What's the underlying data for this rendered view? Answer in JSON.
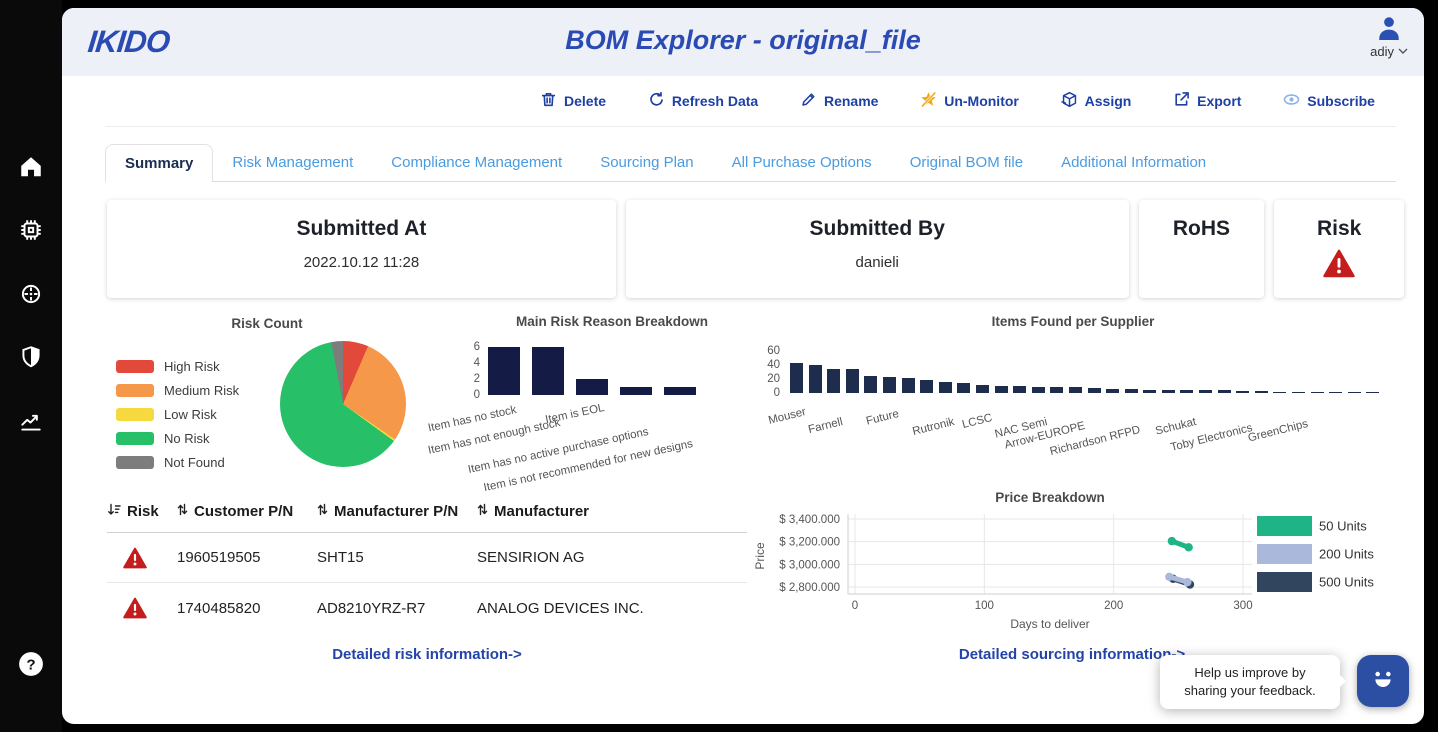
{
  "app": {
    "logo": "IKIDO",
    "title": "BOM Explorer - original_file",
    "user": {
      "name": "adiy"
    }
  },
  "sidebar": {
    "items": [
      {
        "icon": "home-icon"
      },
      {
        "icon": "chip-icon"
      },
      {
        "icon": "target-icon"
      },
      {
        "icon": "shield-icon"
      },
      {
        "icon": "analytics-icon"
      }
    ],
    "help_icon": "help-icon"
  },
  "toolbar": {
    "actions": [
      {
        "label": "Delete",
        "icon": "trash-icon"
      },
      {
        "label": "Refresh Data",
        "icon": "refresh-icon"
      },
      {
        "label": "Rename",
        "icon": "pencil-icon"
      },
      {
        "label": "Un-Monitor",
        "icon": "star-slash-icon"
      },
      {
        "label": "Assign",
        "icon": "cube-icon"
      },
      {
        "label": "Export",
        "icon": "export-icon"
      },
      {
        "label": "Subscribe",
        "icon": "eye-icon"
      }
    ]
  },
  "tabs": [
    {
      "label": "Summary",
      "active": true
    },
    {
      "label": "Risk Management",
      "active": false
    },
    {
      "label": "Compliance Management",
      "active": false
    },
    {
      "label": "Sourcing Plan",
      "active": false
    },
    {
      "label": "All Purchase Options",
      "active": false
    },
    {
      "label": "Original BOM file",
      "active": false
    },
    {
      "label": "Additional Information",
      "active": false
    }
  ],
  "cards": {
    "submitted_at": {
      "title": "Submitted At",
      "value": "2022.10.12 11:28"
    },
    "submitted_by": {
      "title": "Submitted By",
      "value": "danieli"
    },
    "rohs": {
      "title": "RoHS"
    },
    "risk": {
      "title": "Risk",
      "icon": "warning-triangle-icon"
    }
  },
  "table": {
    "columns": [
      {
        "label": "Risk",
        "sort": "desc"
      },
      {
        "label": "Customer P/N",
        "sort": "none"
      },
      {
        "label": "Manufacturer P/N",
        "sort": "none"
      },
      {
        "label": "Manufacturer",
        "sort": "none"
      }
    ],
    "rows": [
      {
        "risk": "high",
        "customer_pn": "1960519505",
        "manufacturer_pn": "SHT15",
        "manufacturer": "SENSIRION AG"
      },
      {
        "risk": "high",
        "customer_pn": "1740485820",
        "manufacturer_pn": "AD8210YRZ-R7",
        "manufacturer": "ANALOG DEVICES INC."
      }
    ]
  },
  "links": {
    "risk": "Detailed risk information->",
    "sourcing": "Detailed sourcing information->"
  },
  "feedback": {
    "tooltip": "Help us improve by sharing your feedback.",
    "icon": "chat-smiley-icon"
  },
  "chart_data": [
    {
      "id": "risk_count",
      "type": "pie",
      "title": "Risk Count",
      "legend_position": "left",
      "slices": [
        {
          "label": "High Risk",
          "value": 6.5,
          "color": "#e2493b"
        },
        {
          "label": "Medium Risk",
          "value": 28,
          "color": "#f5984a"
        },
        {
          "label": "Low Risk",
          "value": 0.5,
          "color": "#f6d93f"
        },
        {
          "label": "No Risk",
          "value": 62,
          "color": "#28bf69"
        },
        {
          "label": "Not Found",
          "value": 3,
          "color": "#7d7d7d"
        }
      ]
    },
    {
      "id": "risk_reasons",
      "type": "bar",
      "title": "Main Risk Reason Breakdown",
      "categories": [
        "Item has no stock",
        "Item has not enough stock",
        "Item is EOL",
        "Item has no active purchase options",
        "Item is not recommended for new designs"
      ],
      "values": [
        6,
        6,
        2,
        1,
        1
      ],
      "ylim": [
        0,
        6
      ],
      "yticks": [
        0,
        2,
        4,
        6
      ],
      "bar_color": "#141b44",
      "grid": false
    },
    {
      "id": "items_per_supplier",
      "type": "bar",
      "title": "Items Found per Supplier",
      "values": [
        43,
        40,
        35,
        34,
        24,
        23,
        21,
        18,
        16,
        14,
        11,
        10,
        10,
        9,
        8,
        8,
        7,
        6,
        6,
        5,
        5,
        4,
        4,
        4,
        3,
        3,
        2,
        2,
        2,
        1,
        1,
        1
      ],
      "labels": [
        {
          "index": 0,
          "label": "Mouser"
        },
        {
          "index": 2,
          "label": "Farnell"
        },
        {
          "index": 5,
          "label": "Future"
        },
        {
          "index": 8,
          "label": "Rutronik"
        },
        {
          "index": 10,
          "label": "LCSC"
        },
        {
          "index": 13,
          "label": "NAC Semi"
        },
        {
          "index": 15,
          "label": "Arrow-EUROPE"
        },
        {
          "index": 18,
          "label": "Richardson RFPD"
        },
        {
          "index": 21,
          "label": "Schukat"
        },
        {
          "index": 24,
          "label": "Toby Electronics"
        },
        {
          "index": 27,
          "label": "GreenChips"
        }
      ],
      "ylim": [
        0,
        60
      ],
      "yticks": [
        0,
        20,
        40,
        60
      ],
      "bar_color": "#1e2d4d",
      "grid": false
    },
    {
      "id": "price_breakdown",
      "type": "line",
      "title": "Price Breakdown",
      "xlabel": "Days to deliver",
      "ylabel": "Price",
      "xticks": [
        0,
        100,
        200,
        300
      ],
      "xlim": [
        0,
        300
      ],
      "yticks": [
        {
          "label": "$ 3,400.000",
          "value": 3400
        },
        {
          "label": "$ 3,200.000",
          "value": 3200
        },
        {
          "label": "$ 3,000.000",
          "value": 3000
        },
        {
          "label": "$ 2,800.000",
          "value": 2800
        }
      ],
      "grid": true,
      "legend_position": "right",
      "series": [
        {
          "name": "50 Units",
          "color": "#1fb486",
          "points": [
            [
              245,
              3205
            ],
            [
              258,
              3150
            ]
          ]
        },
        {
          "name": "500 Units",
          "color": "#32455f",
          "points": [
            [
              246,
              2872
            ],
            [
              259,
              2822
            ]
          ]
        },
        {
          "name": "200 Units",
          "color": "#a9b8db",
          "points": [
            [
              243,
              2890
            ],
            [
              257,
              2843
            ]
          ]
        }
      ],
      "legend_order": [
        "50 Units",
        "200 Units",
        "500 Units"
      ]
    }
  ]
}
